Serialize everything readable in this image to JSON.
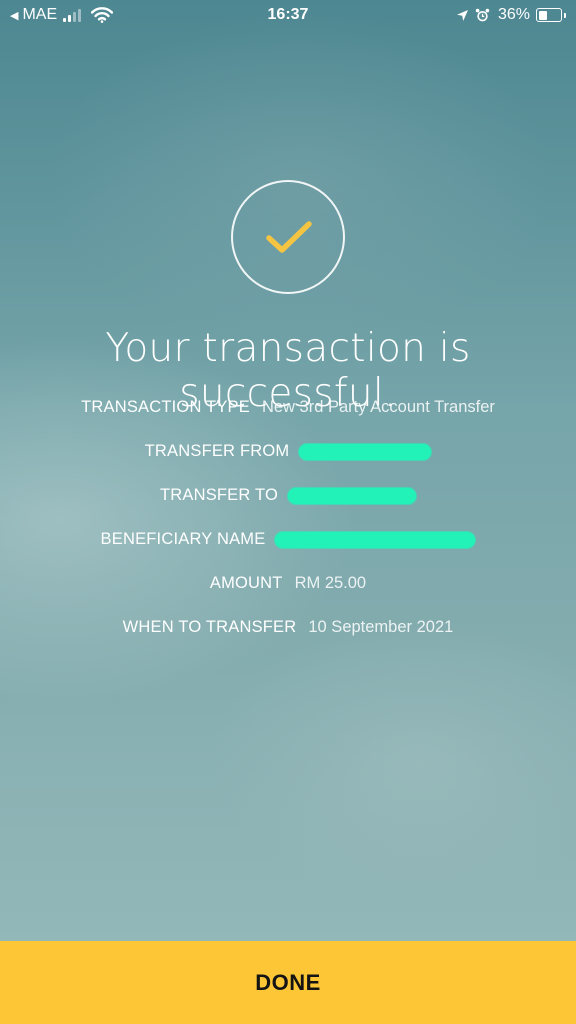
{
  "status_bar": {
    "back_glyph": "◀",
    "carrier": "MAE",
    "time": "16:37",
    "battery_percent": "36%",
    "battery_level": 0.36,
    "icons": [
      "signal-icon",
      "wifi-icon",
      "location-icon",
      "alarm-icon",
      "battery-icon"
    ]
  },
  "success": {
    "icon": "checkmark-icon",
    "accent_color": "#f5c542",
    "headline": "Your transaction is successful."
  },
  "details": [
    {
      "label": "TRANSACTION TYPE",
      "value": "New 3rd Party Account Transfer"
    },
    {
      "label": "TRANSFER FROM",
      "value": ""
    },
    {
      "label": "TRANSFER TO",
      "value": ""
    },
    {
      "label": "BENEFICIARY NAME",
      "value": ""
    },
    {
      "label": "AMOUNT",
      "value": "RM 25.00"
    },
    {
      "label": "WHEN TO TRANSFER",
      "value": "10 September 2021"
    }
  ],
  "done_button": {
    "label": "DONE",
    "color": "#fcc636"
  }
}
